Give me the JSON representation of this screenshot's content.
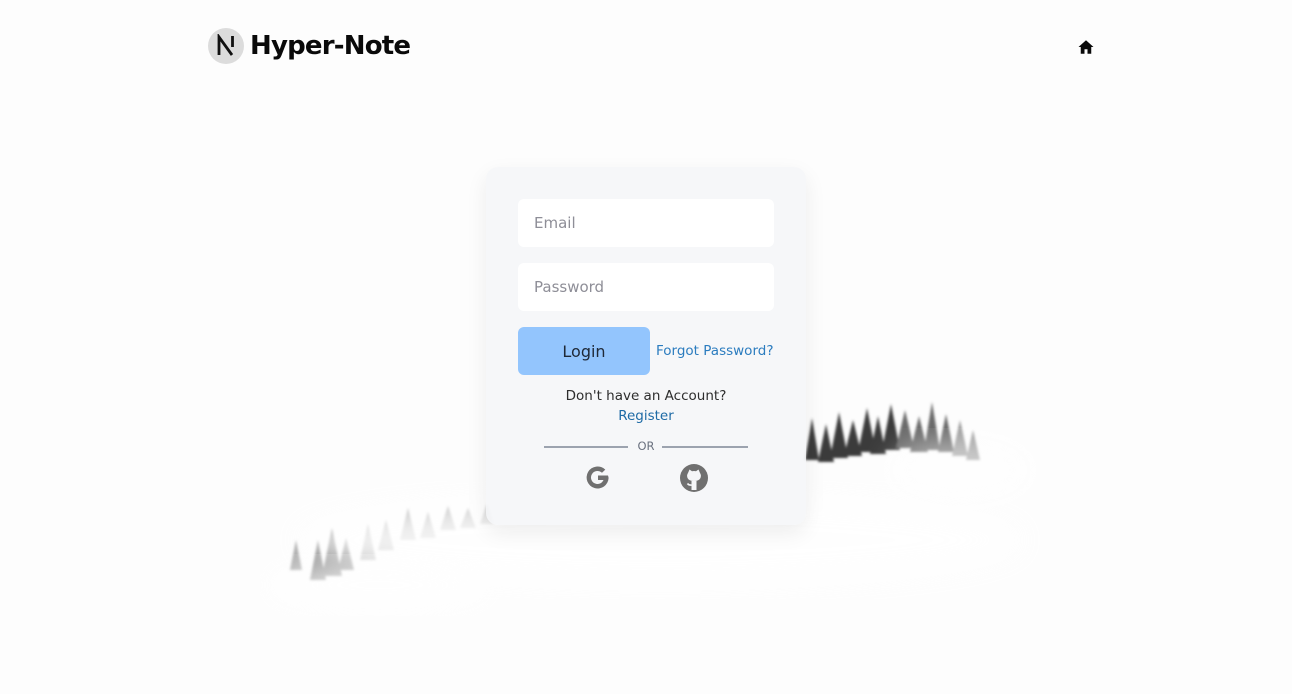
{
  "header": {
    "brand_name": "Hyper-Note",
    "logo_icon": "hyper-note-logo-icon",
    "home_icon": "home-icon"
  },
  "login_form": {
    "email_placeholder": "Email",
    "email_value": "",
    "password_placeholder": "Password",
    "password_value": "",
    "login_label": "Login",
    "forgot_password_label": "Forgot Password?",
    "no_account_text": "Don't have an Account?",
    "register_label": "Register",
    "or_text": "OR",
    "social_icons": [
      "google-icon",
      "github-icon"
    ]
  },
  "colors": {
    "login_button": "#93c5fd",
    "link": "#2b7cbf",
    "card_background": "#f5f6f8"
  }
}
